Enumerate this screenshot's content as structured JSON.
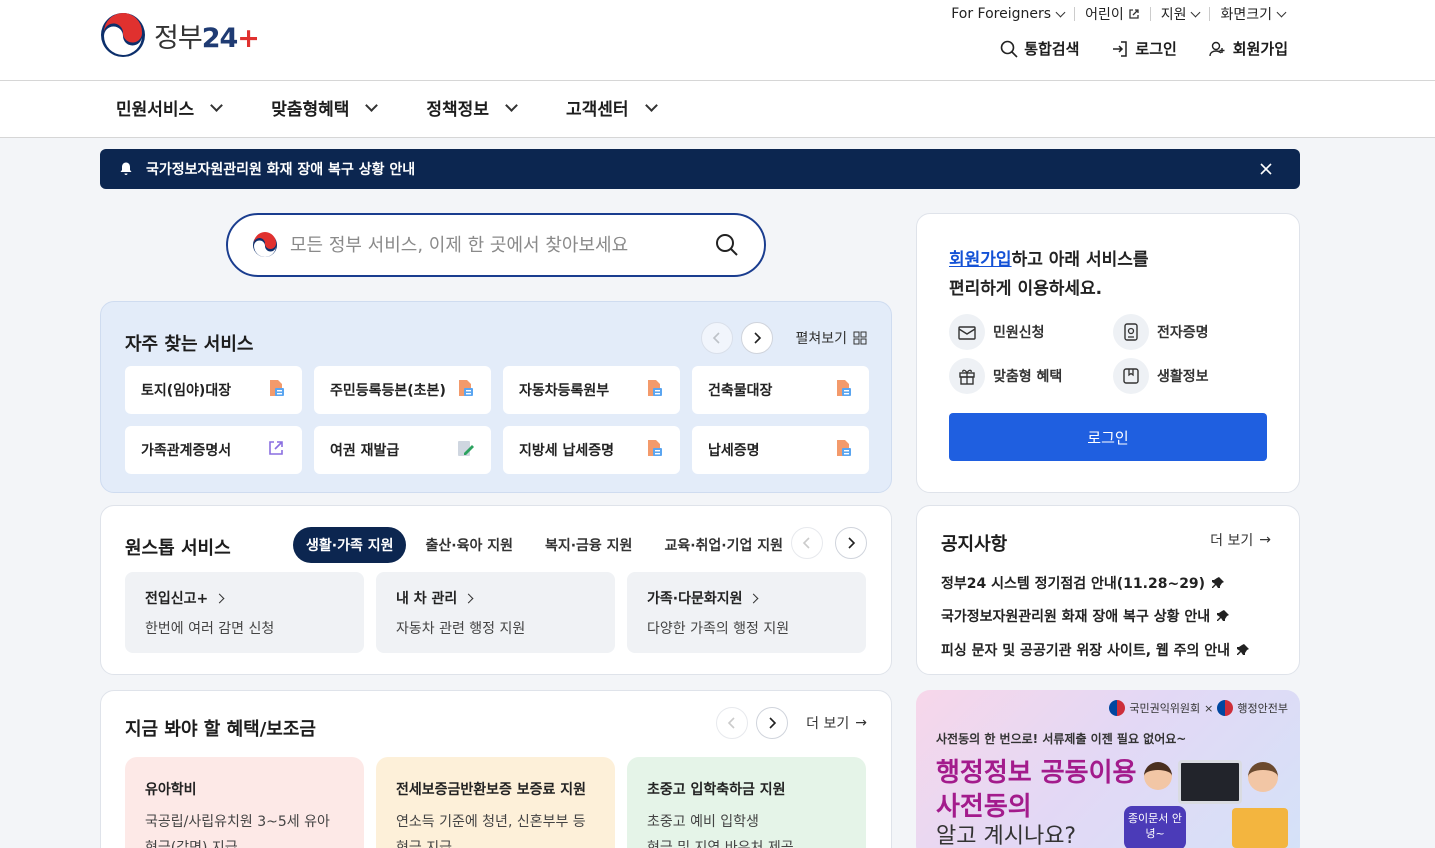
{
  "header": {
    "logo_text": "정부",
    "logo_num": "24",
    "util": [
      {
        "label": "For Foreigners",
        "type": "dropdown"
      },
      {
        "label": "어린이",
        "type": "external"
      },
      {
        "label": "지원",
        "type": "dropdown"
      },
      {
        "label": "화면크기",
        "type": "dropdown"
      }
    ],
    "actions": {
      "search": "통합검색",
      "login": "로그인",
      "signup": "회원가입"
    }
  },
  "gnb": [
    "민원서비스",
    "맞춤형혜택",
    "정책정보",
    "고객센터"
  ],
  "alert": {
    "text": "국가정보자원관리원 화재 장애 복구 상황 안내"
  },
  "search": {
    "placeholder": "모든 정부 서비스, 이제 한 곳에서 찾아보세요"
  },
  "frequent": {
    "title": "자주 찾는 서비스",
    "expand_label": "펼쳐보기",
    "items": [
      {
        "label": "토지(임야)대장",
        "icon": "document-icon"
      },
      {
        "label": "주민등록등본(초본)",
        "icon": "document-icon"
      },
      {
        "label": "자동차등록원부",
        "icon": "document-icon"
      },
      {
        "label": "건축물대장",
        "icon": "document-icon"
      },
      {
        "label": "가족관계증명서",
        "icon": "external-link-icon"
      },
      {
        "label": "여권 재발급",
        "icon": "edit-icon"
      },
      {
        "label": "지방세 납세증명",
        "icon": "document-icon"
      },
      {
        "label": "납세증명",
        "icon": "document-icon"
      }
    ]
  },
  "onestop": {
    "title": "원스톱 서비스",
    "tabs": [
      "생활·가족 지원",
      "출산·육아 지원",
      "복지·금융 지원",
      "교육·취업·기업 지원"
    ],
    "items": [
      {
        "title": "전입신고+",
        "desc": "한번에 여러 감면 신청"
      },
      {
        "title": "내 차 관리",
        "desc": "자동차 관련 행정 지원"
      },
      {
        "title": "가족·다문화지원",
        "desc": "다양한 가족의 행정 지원"
      }
    ]
  },
  "benefits": {
    "title": "지금 봐야 할 혜택/보조금",
    "more_label": "더 보기",
    "items": [
      {
        "title": "유아학비",
        "line1": "국공립/사립유치원 3~5세 유아",
        "line2": "현금(감면) 지급",
        "color": "#fde9e7"
      },
      {
        "title": "전세보증금반환보증 보증료 지원",
        "line1": "연소득 기준에 청년, 신혼부부 등",
        "line2": "현금 지급",
        "color": "#fdf0d9"
      },
      {
        "title": "초중고 입학축하금 지원",
        "line1": "초중고 예비 입학생",
        "line2": "현금 및 지역 바우처 제공",
        "color": "#e5f4e8"
      }
    ]
  },
  "login_card": {
    "link_text": "회원가입",
    "msg1": "하고 아래 서비스를",
    "msg2": "편리하게 이용하세요.",
    "features": [
      "민원신청",
      "전자증명",
      "맞춤형 혜택",
      "생활정보"
    ],
    "button": "로그인"
  },
  "notice": {
    "title": "공지사항",
    "more_label": "더 보기",
    "items": [
      "정부24 시스템 정기점검 안내(11.28~29)",
      "국가정보자원관리원 화재 장애 복구 상황 안내",
      "피싱 문자 및 공공기관 위장 사이트, 웹 주의 안내"
    ]
  },
  "banner": {
    "org1": "국민권익위원회",
    "org2": "행정안전부",
    "sub": "사전동의 한 번으로! 서류제출 이젠 필요 없어요~",
    "h1": "행정정보 공동이용",
    "h2": "사전동의",
    "h3": "알고 계시나요?",
    "bubble": "종이문서 안녕~"
  }
}
